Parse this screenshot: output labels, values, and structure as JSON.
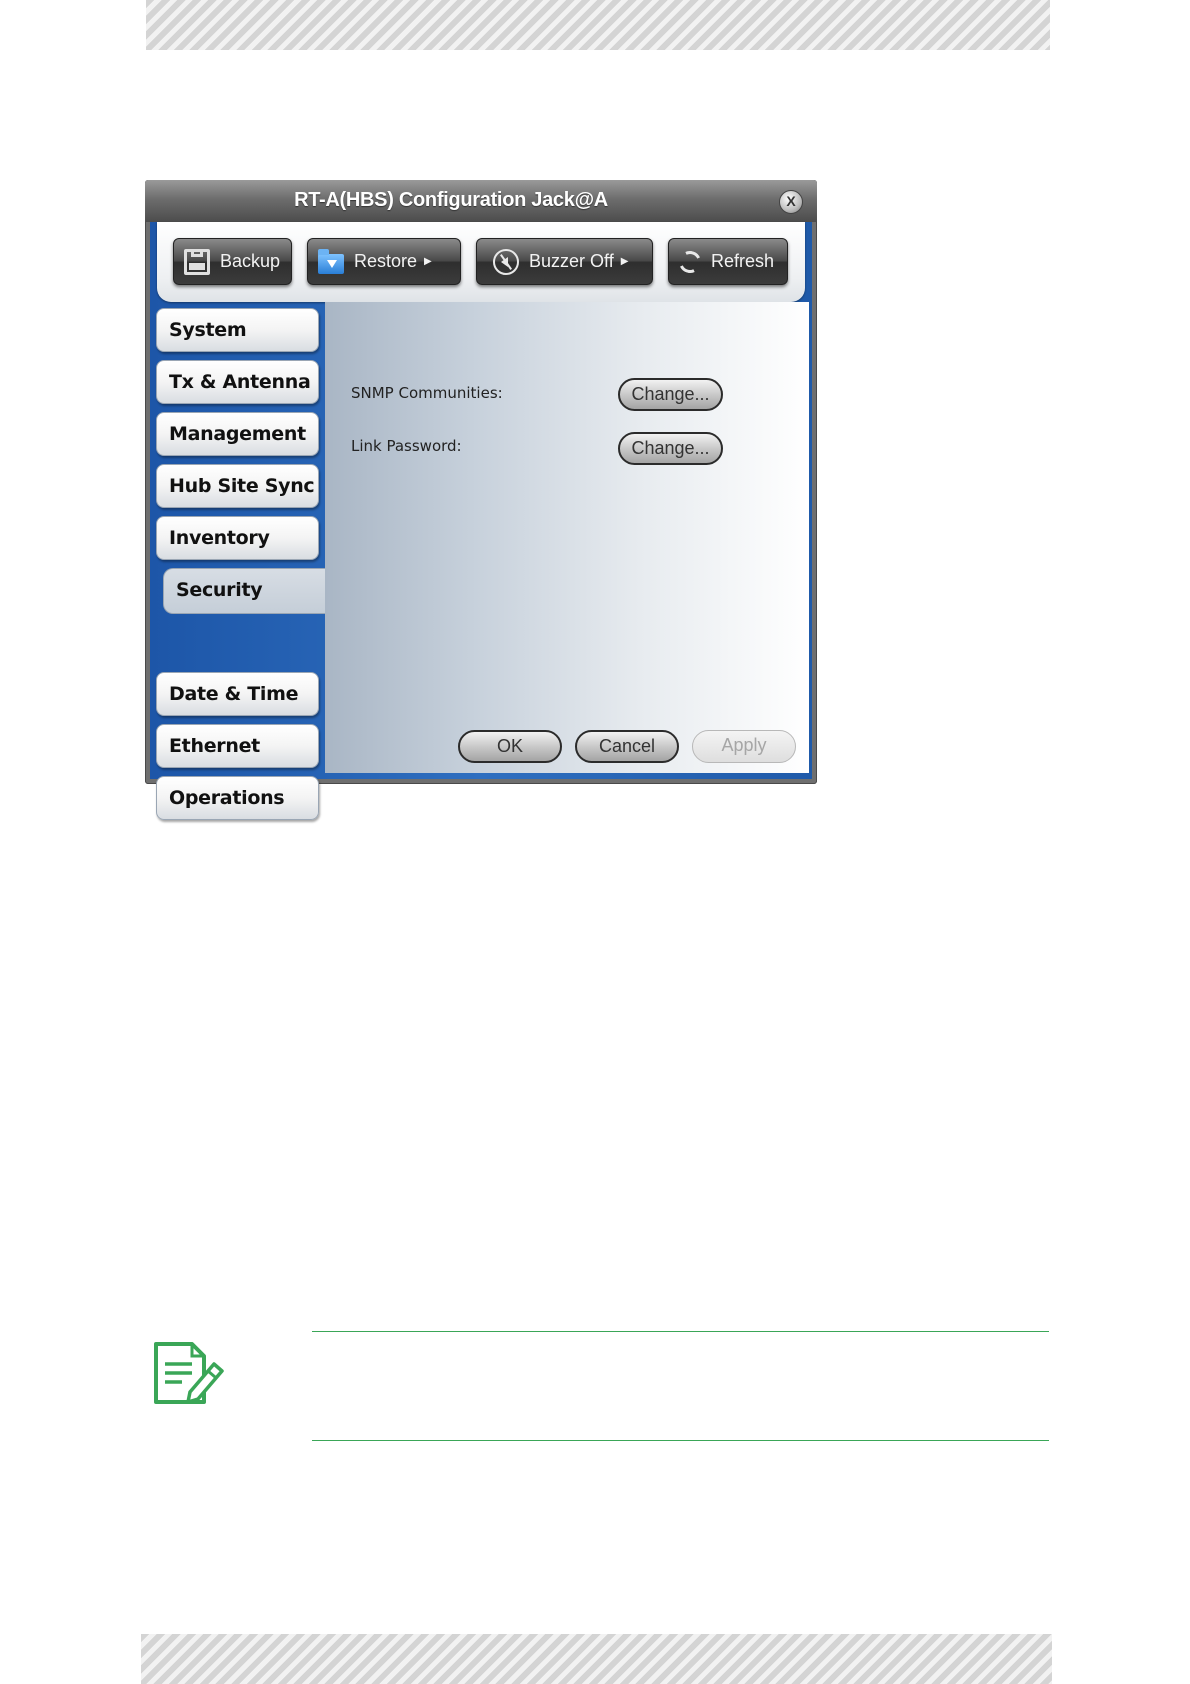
{
  "window": {
    "title": "RT-A(HBS) Configuration Jack@A",
    "close_label": "X"
  },
  "toolbar": {
    "backup_label": "Backup",
    "restore_label": "Restore",
    "buzzer_label": "Buzzer Off",
    "refresh_label": "Refresh"
  },
  "nav": {
    "items": [
      "System",
      "Tx & Antenna",
      "Management",
      "Hub Site Sync",
      "Inventory",
      "Security",
      "Date & Time",
      "Ethernet",
      "Operations"
    ],
    "active": "Security"
  },
  "security": {
    "snmp_label": "SNMP Communities:",
    "snmp_button": "Change...",
    "link_label": "Link Password:",
    "link_button": "Change..."
  },
  "footer": {
    "ok_label": "OK",
    "cancel_label": "Cancel",
    "apply_label": "Apply"
  },
  "colors": {
    "note_accent": "#3aa657",
    "frame_blue": "#2f6fc0"
  },
  "icons": {
    "note": "note-edit-icon"
  }
}
